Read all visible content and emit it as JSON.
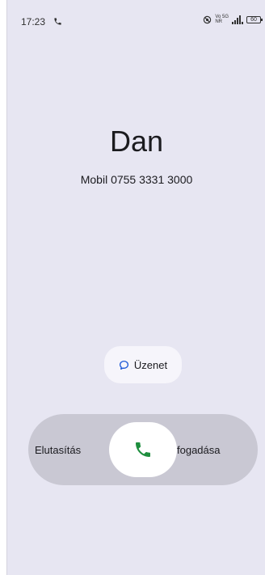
{
  "status_bar": {
    "time": "17:23",
    "network_top": "Vo 5G",
    "network_bottom": "NR",
    "battery": "60"
  },
  "caller": {
    "name": "Dan",
    "number": "Mobil 0755 3331 3000"
  },
  "actions": {
    "message_label": "Üzenet",
    "decline_label": "Elutasítás",
    "accept_label": "fogadása"
  },
  "colors": {
    "background": "#e7e6f2",
    "track": "#c9c8d3",
    "accept_green": "#1e8e3e",
    "message_icon_blue": "#1a56d6"
  },
  "icons": {
    "status_call": "phone-icon",
    "mute": "mute-icon",
    "signal": "signal-icon",
    "message": "chat-bubble-icon",
    "answer": "phone-icon"
  }
}
